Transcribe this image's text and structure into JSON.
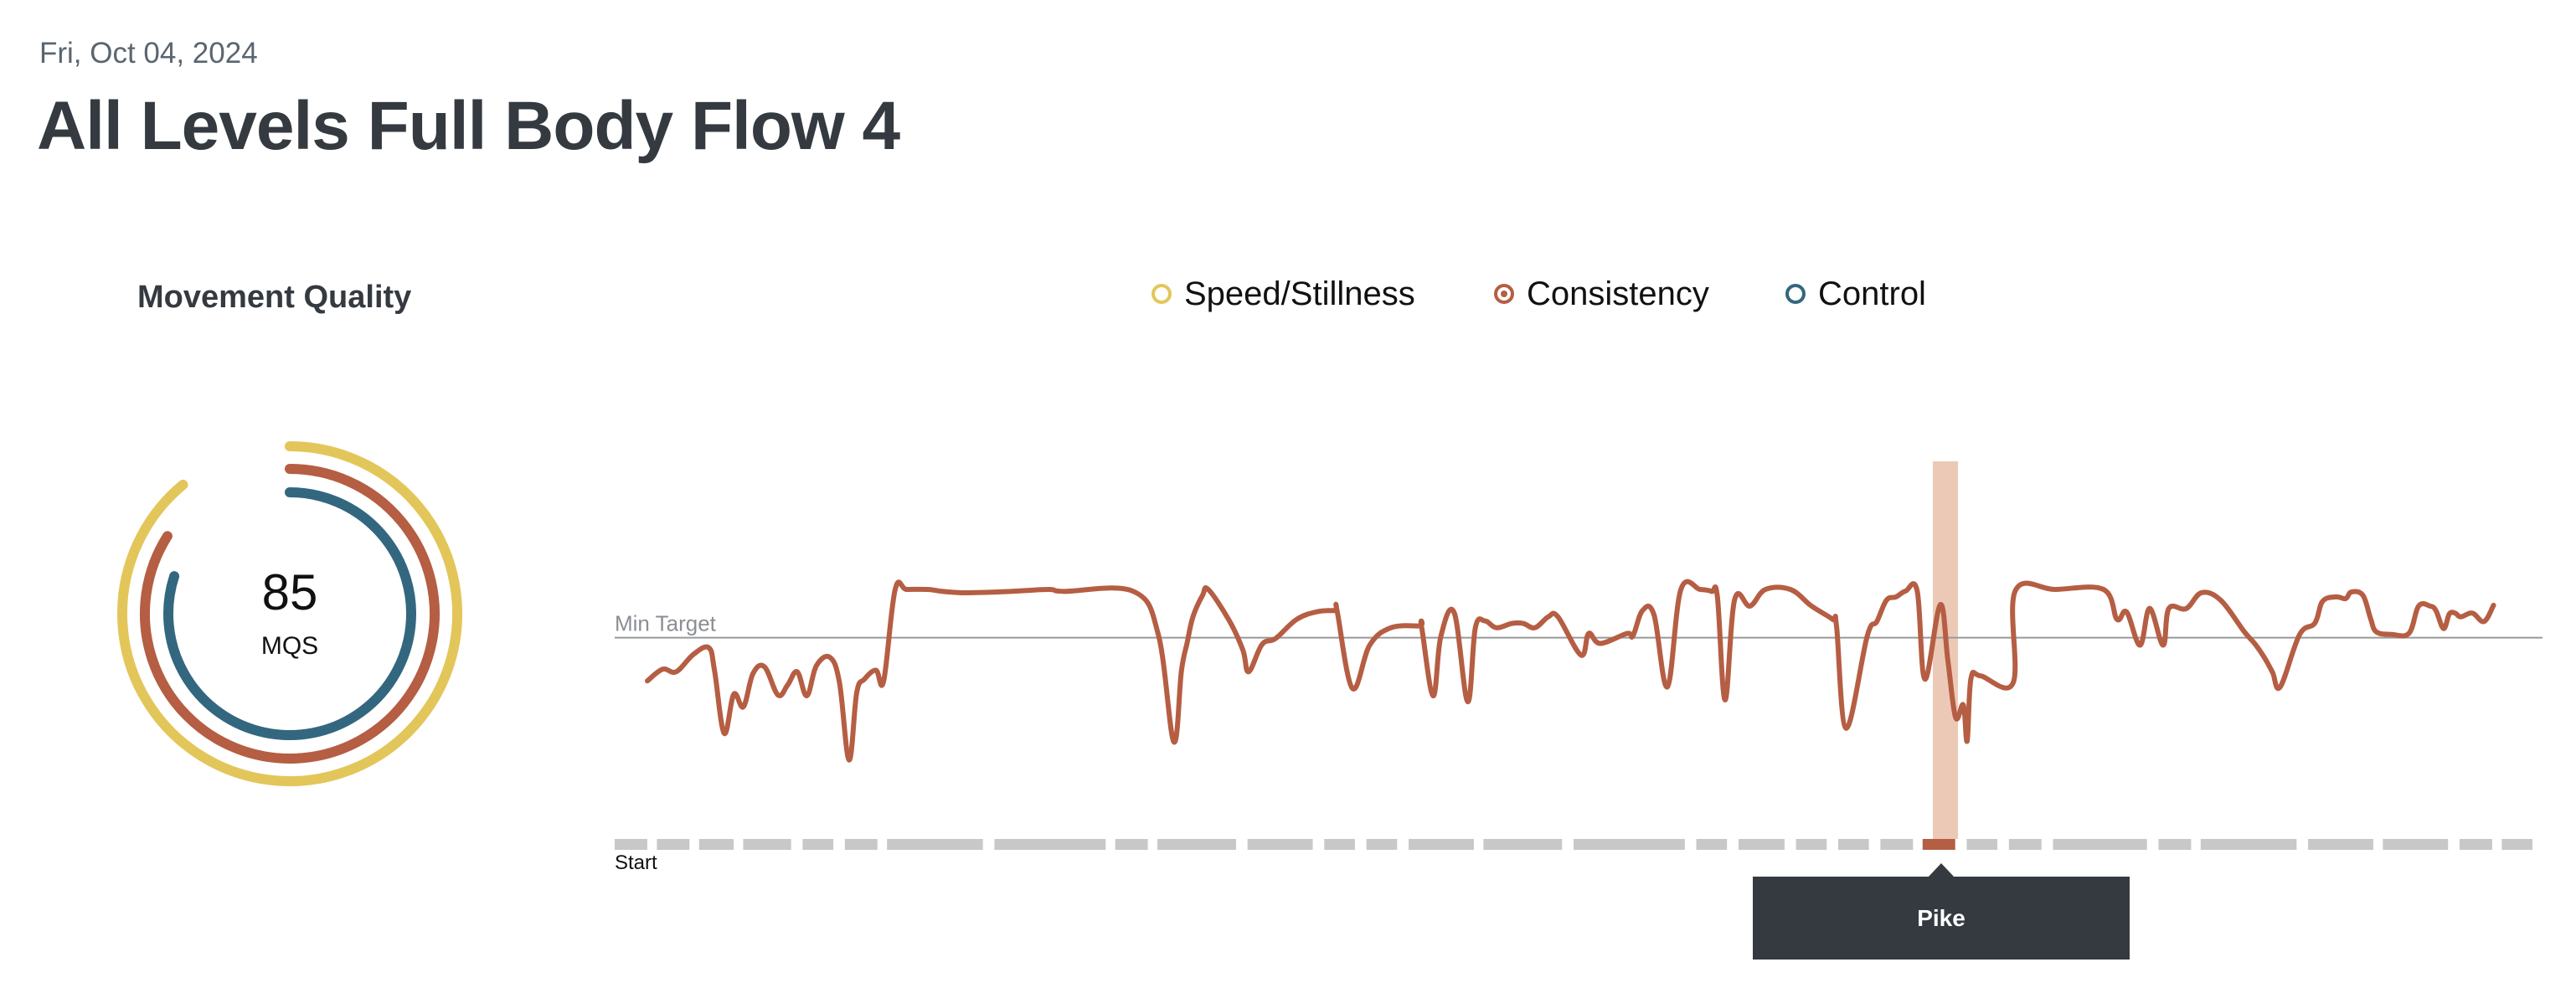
{
  "header": {
    "date": "Fri, Oct 04, 2024",
    "title": "All Levels Full Body Flow 4"
  },
  "movement_quality": {
    "label": "Movement Quality",
    "score": "85",
    "score_unit": "MQS",
    "rings": [
      {
        "name": "Speed/Stillness",
        "color": "#e3c65a",
        "fraction": 0.89
      },
      {
        "name": "Consistency",
        "color": "#b55e43",
        "fraction": 0.84
      },
      {
        "name": "Control",
        "color": "#33677f",
        "fraction": 0.8
      }
    ]
  },
  "legend": [
    {
      "label": "Speed/Stillness",
      "color": "#e3c65a",
      "selected": false
    },
    {
      "label": "Consistency",
      "color": "#b55e43",
      "selected": true
    },
    {
      "label": "Control",
      "color": "#33677f",
      "selected": false
    }
  ],
  "chart_data": {
    "type": "line",
    "title": "",
    "xlabel": "",
    "ylabel": "",
    "series": [
      {
        "name": "Consistency",
        "color": "#b55e43",
        "x": [
          0.017,
          0.025,
          0.032,
          0.041,
          0.049,
          0.052,
          0.057,
          0.062,
          0.067,
          0.072,
          0.078,
          0.085,
          0.09,
          0.095,
          0.1,
          0.105,
          0.112,
          0.117,
          0.122,
          0.126,
          0.13,
          0.136,
          0.14,
          0.146,
          0.152,
          0.163,
          0.171,
          0.183,
          0.206,
          0.226,
          0.234,
          0.27,
          0.283,
          0.291,
          0.295,
          0.298,
          0.301,
          0.306,
          0.309,
          0.32,
          0.327,
          0.33,
          0.337,
          0.344,
          0.355,
          0.366,
          0.375,
          0.376,
          0.384,
          0.393,
          0.404,
          0.419,
          0.42,
          0.426,
          0.43,
          0.437,
          0.444,
          0.448,
          0.453,
          0.459,
          0.467,
          0.473,
          0.479,
          0.486,
          0.491,
          0.503,
          0.507,
          0.513,
          0.527,
          0.53,
          0.535,
          0.541,
          0.548,
          0.555,
          0.565,
          0.571,
          0.574,
          0.578,
          0.583,
          0.591,
          0.599,
          0.612,
          0.623,
          0.634,
          0.636,
          0.641,
          0.652,
          0.657,
          0.662,
          0.667,
          0.672,
          0.678,
          0.682,
          0.69,
          0.694,
          0.698,
          0.702,
          0.704,
          0.706,
          0.711,
          0.728,
          0.729,
          0.75,
          0.775,
          0.782,
          0.787,
          0.794,
          0.799,
          0.806,
          0.809,
          0.818,
          0.826,
          0.836,
          0.848,
          0.854,
          0.859,
          0.863,
          0.867,
          0.877,
          0.885,
          0.889,
          0.896,
          0.901,
          0.904,
          0.91,
          0.914,
          0.917,
          0.925,
          0.934,
          0.939,
          0.945,
          0.948,
          0.952,
          0.955,
          0.958,
          0.961,
          0.967,
          0.973,
          0.978
        ],
        "y": [
          50.2,
          56.2,
          54.9,
          63.8,
          67.2,
          55.3,
          23.4,
          43.4,
          37.0,
          54.0,
          57.4,
          43.0,
          48.1,
          54.9,
          42.6,
          58.0,
          62.3,
          49.4,
          9.8,
          44.3,
          51.1,
          55.7,
          50.2,
          97.0,
          97.0,
          97.0,
          96.0,
          95.3,
          96.0,
          97.0,
          96.0,
          96.0,
          73.8,
          19.1,
          55.3,
          69.8,
          83.0,
          94.0,
          97.0,
          80.9,
          66.0,
          54.9,
          68.9,
          71.9,
          81.7,
          85.7,
          86.2,
          86.2,
          46.4,
          68.5,
          77.4,
          78.3,
          77.9,
          42.6,
          72.8,
          85.1,
          39.6,
          77.4,
          80.9,
          77.4,
          79.6,
          79.6,
          77.4,
          83.0,
          83.0,
          63.4,
          74.5,
          69.4,
          74.5,
          73.2,
          86.2,
          84.0,
          47.2,
          97.0,
          97.0,
          96.0,
          93.2,
          40.5,
          91.9,
          88.5,
          97.0,
          97.0,
          88.5,
          81.7,
          78.3,
          26.0,
          73.2,
          80.6,
          91.5,
          93.2,
          96.2,
          96.2,
          51.1,
          89.2,
          60.4,
          31.5,
          37.9,
          19.5,
          51.5,
          52.8,
          49.4,
          96.2,
          97.0,
          97.0,
          81.7,
          85.5,
          68.5,
          87.3,
          68.5,
          87.3,
          87.2,
          95.3,
          91.5,
          75.7,
          68.9,
          61.7,
          54.5,
          47.2,
          73.8,
          79.8,
          90.9,
          93.2,
          92.3,
          95.7,
          94.0,
          82.1,
          75.3,
          74.0,
          74.6,
          88.5,
          88.5,
          86.2,
          77.0,
          84.5,
          84.9,
          83.0,
          84.9,
          80.6,
          88.9,
          93.2,
          93.6
        ],
        "note": "y in percent of plot range; Min Target line ≈ 72.3"
      }
    ],
    "reference_lines": [
      {
        "label": "Min Target",
        "value": 72.3
      }
    ],
    "ylim": [
      0,
      100
    ],
    "xlim": [
      0,
      1
    ],
    "x_start_label": "Start",
    "grid": false,
    "legend_position": "top-center",
    "highlight": {
      "label": "Pike",
      "x_start": 0.6727,
      "x_end": 0.6855
    }
  },
  "timeline": {
    "start_label": "Start",
    "segments": [
      {
        "start": 0.0,
        "end": 0.017
      },
      {
        "start": 0.022,
        "end": 0.039
      },
      {
        "start": 0.044,
        "end": 0.062
      },
      {
        "start": 0.067,
        "end": 0.092
      },
      {
        "start": 0.098,
        "end": 0.114
      },
      {
        "start": 0.12,
        "end": 0.137
      },
      {
        "start": 0.142,
        "end": 0.192
      },
      {
        "start": 0.198,
        "end": 0.256
      },
      {
        "start": 0.261,
        "end": 0.278
      },
      {
        "start": 0.283,
        "end": 0.324
      },
      {
        "start": 0.33,
        "end": 0.364
      },
      {
        "start": 0.37,
        "end": 0.386
      },
      {
        "start": 0.392,
        "end": 0.408
      },
      {
        "start": 0.414,
        "end": 0.448
      },
      {
        "start": 0.453,
        "end": 0.494
      },
      {
        "start": 0.5,
        "end": 0.558
      },
      {
        "start": 0.564,
        "end": 0.58
      },
      {
        "start": 0.586,
        "end": 0.61
      },
      {
        "start": 0.616,
        "end": 0.632
      },
      {
        "start": 0.638,
        "end": 0.654
      },
      {
        "start": 0.66,
        "end": 0.677
      },
      {
        "start": 0.682,
        "end": 0.699,
        "active": true
      },
      {
        "start": 0.705,
        "end": 0.721
      },
      {
        "start": 0.727,
        "end": 0.744
      },
      {
        "start": 0.75,
        "end": 0.799
      },
      {
        "start": 0.805,
        "end": 0.822
      },
      {
        "start": 0.827,
        "end": 0.877
      },
      {
        "start": 0.883,
        "end": 0.917
      },
      {
        "start": 0.922,
        "end": 0.956
      },
      {
        "start": 0.962,
        "end": 0.979
      },
      {
        "start": 0.984,
        "end": 1.0
      }
    ],
    "active_color": "#b55e43",
    "inactive_color": "#c8c8c8",
    "highlight_color": "#ecc9b7"
  },
  "tooltip": {
    "label": "Pike"
  }
}
